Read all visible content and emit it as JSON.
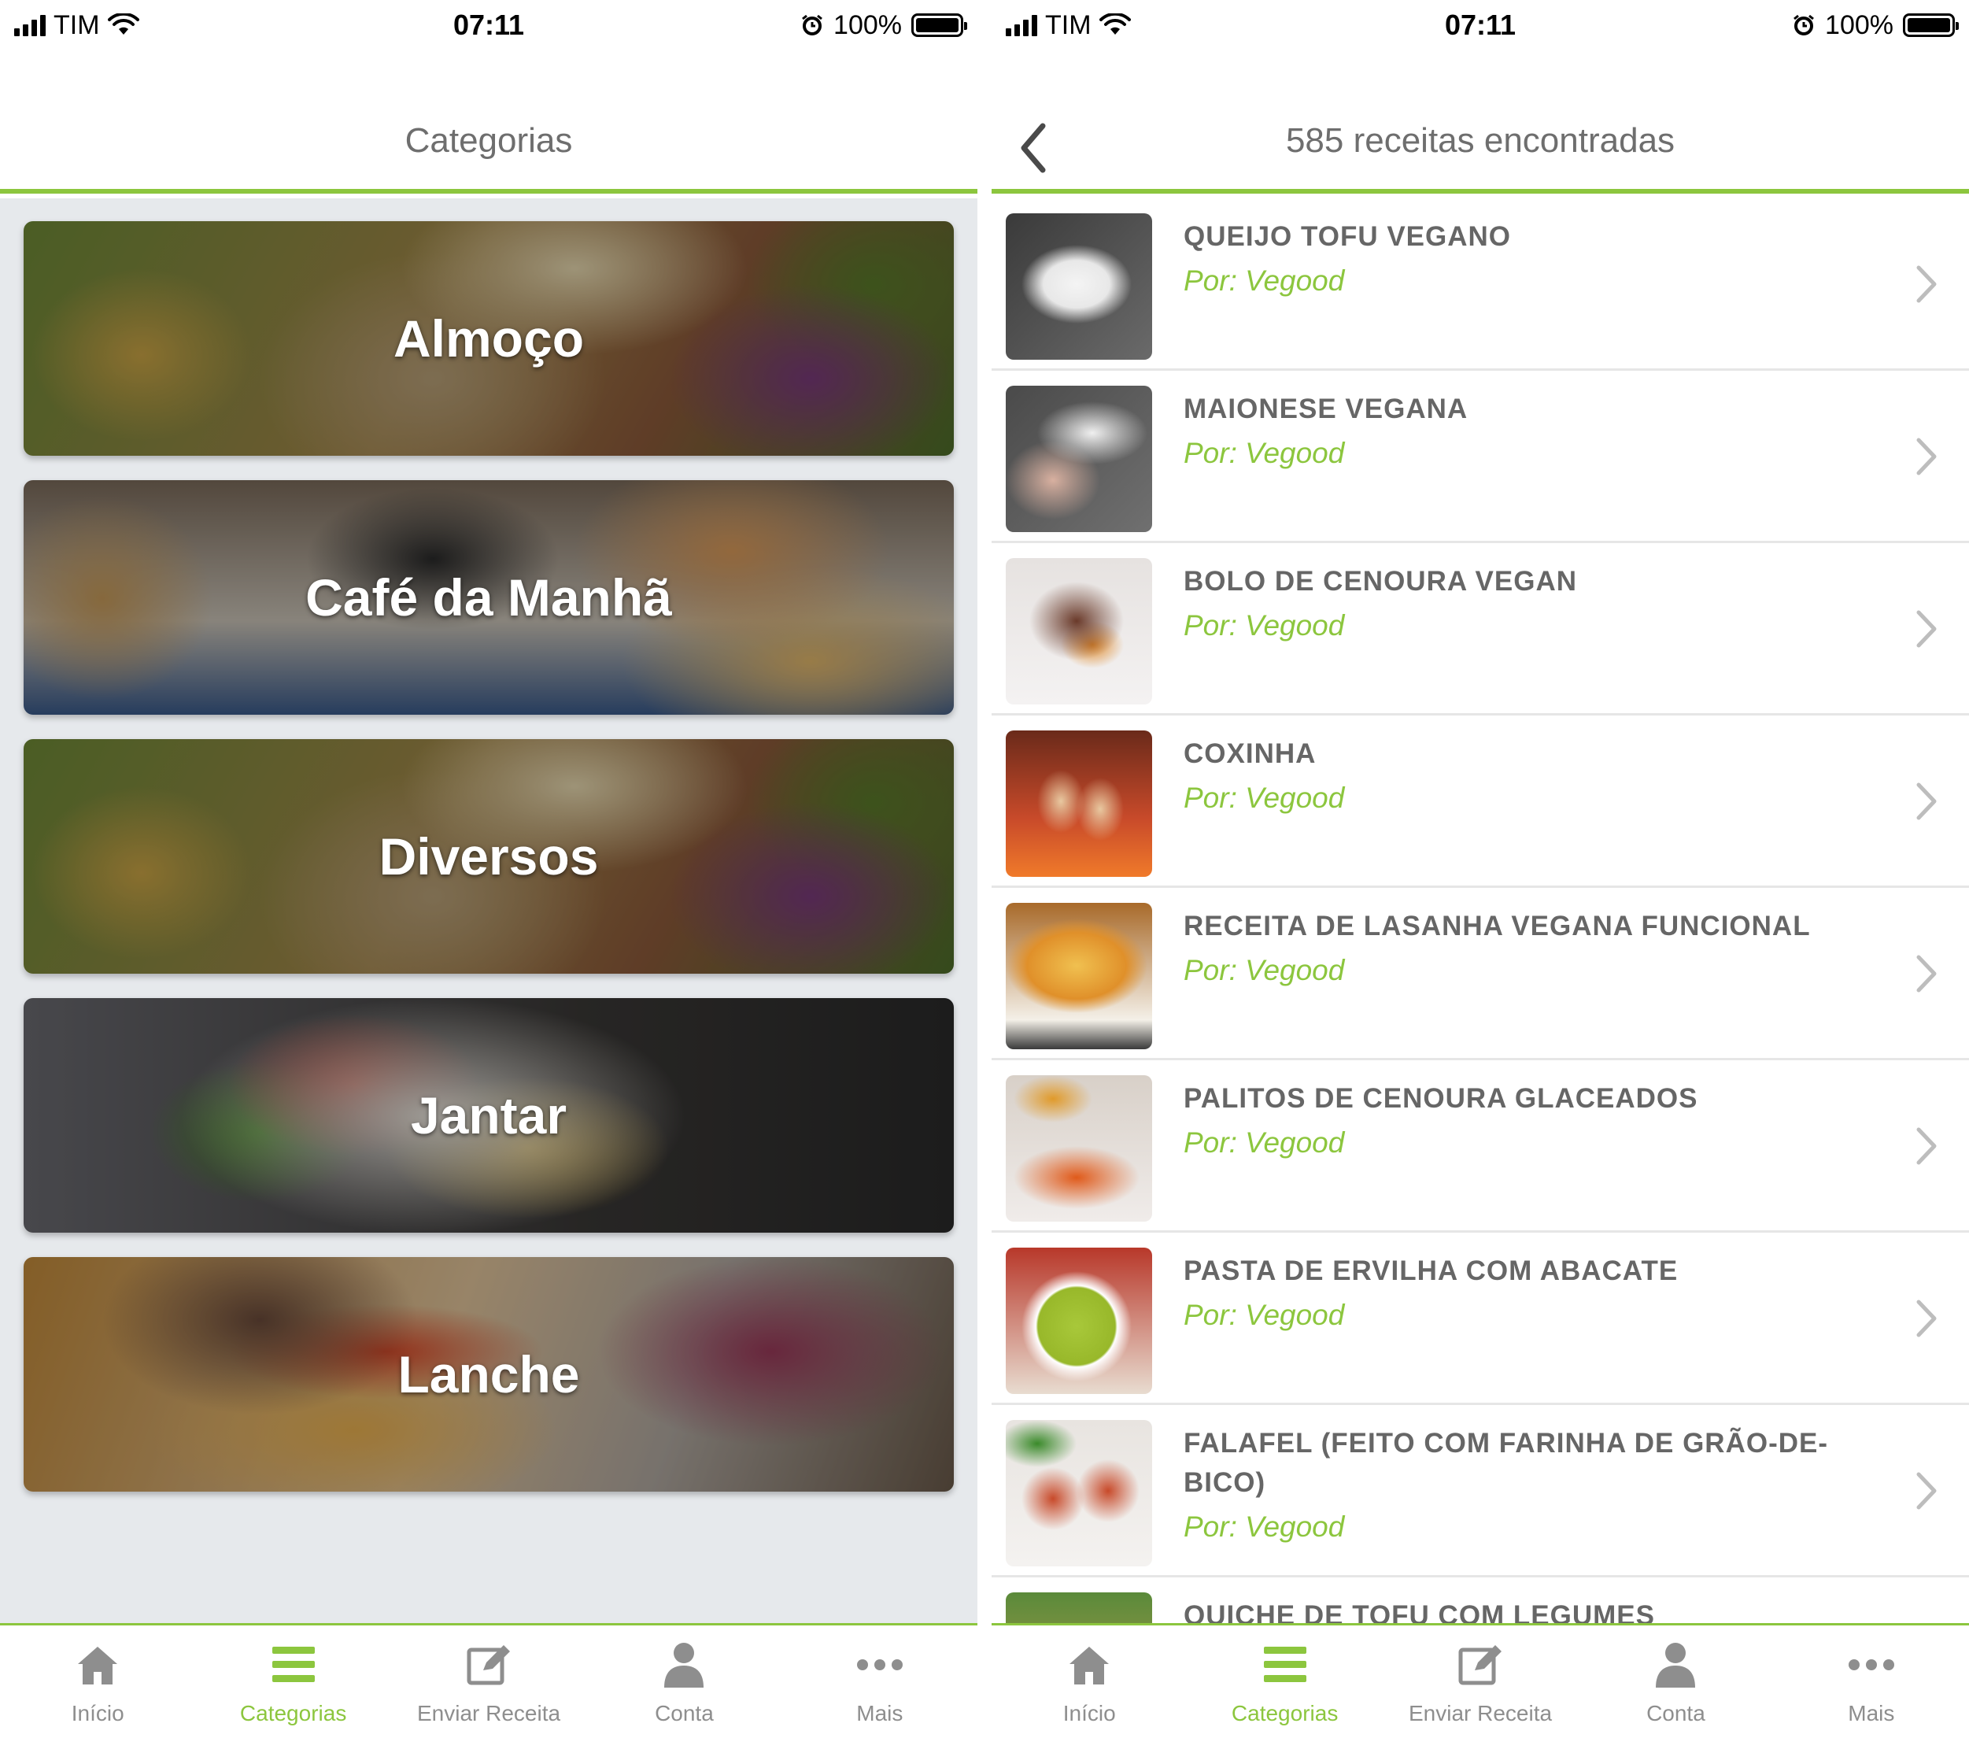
{
  "status_bar": {
    "carrier": "TIM",
    "time": "07:11",
    "battery": "100%"
  },
  "left_screen": {
    "header_title": "Categorias",
    "categories": [
      {
        "label": "Almoço"
      },
      {
        "label": "Café da Manhã"
      },
      {
        "label": "Diversos"
      },
      {
        "label": "Jantar"
      },
      {
        "label": "Lanche"
      }
    ]
  },
  "right_screen": {
    "header_title": "585 receitas encontradas",
    "recipes": [
      {
        "title": "QUEIJO TOFU VEGANO",
        "author": "Por: Vegood"
      },
      {
        "title": "MAIONESE VEGANA",
        "author": "Por: Vegood"
      },
      {
        "title": "BOLO DE CENOURA VEGAN",
        "author": "Por: Vegood"
      },
      {
        "title": "COXINHA",
        "author": "Por: Vegood"
      },
      {
        "title": "RECEITA DE LASANHA VEGANA FUNCIONAL",
        "author": "Por: Vegood"
      },
      {
        "title": "PALITOS DE CENOURA GLACEADOS",
        "author": "Por: Vegood"
      },
      {
        "title": "PASTA DE ERVILHA COM ABACATE",
        "author": "Por: Vegood"
      },
      {
        "title": "FALAFEL (FEITO COM FARINHA DE GRÃO-DE-BICO)",
        "author": "Por: Vegood"
      },
      {
        "title": "QUICHE DE TOFU COM LEGUMES",
        "author": ""
      }
    ]
  },
  "tab_bar": {
    "tabs": [
      {
        "label": "Início",
        "icon": "home-icon"
      },
      {
        "label": "Categorias",
        "icon": "list-icon",
        "active": true
      },
      {
        "label": "Enviar Receita",
        "icon": "edit-icon"
      },
      {
        "label": "Conta",
        "icon": "user-icon"
      },
      {
        "label": "Mais",
        "icon": "more-icon"
      }
    ]
  },
  "colors": {
    "accent": "#8cc63e",
    "header_text": "#6e6e6e",
    "list_text": "#666666",
    "tab_inactive": "#8e8e8e",
    "background_gray": "#e6e9ec"
  }
}
